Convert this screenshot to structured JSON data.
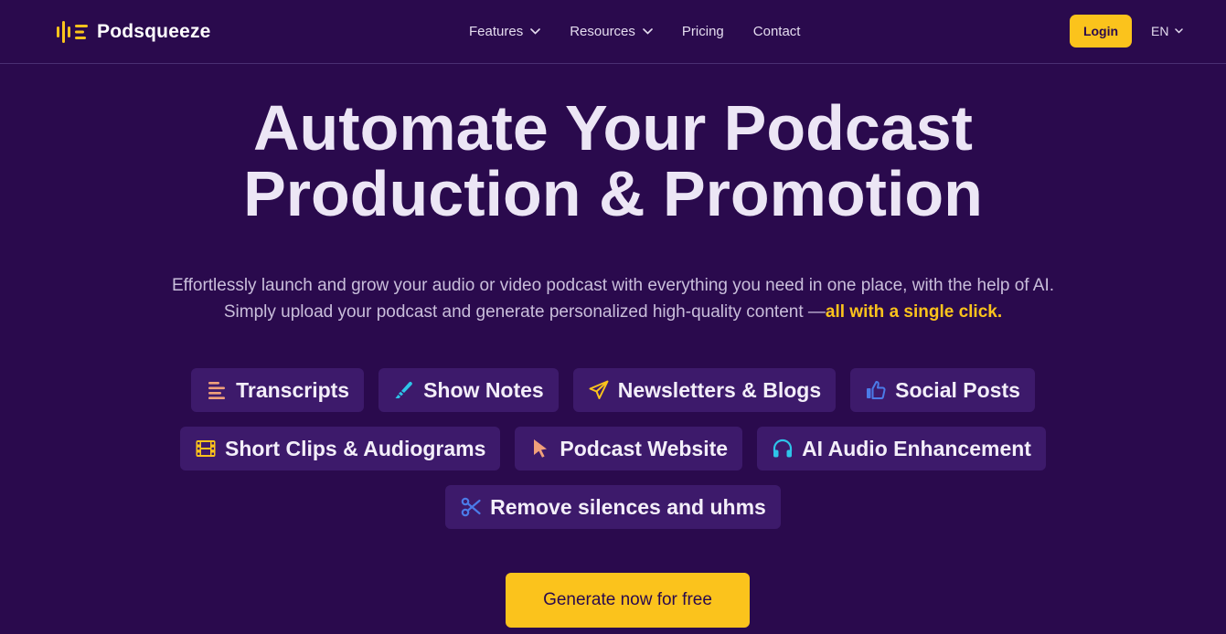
{
  "brand": {
    "name": "Podsqueeze",
    "accent": "#fbc31c",
    "background": "#2a0a4d"
  },
  "nav": {
    "items": [
      {
        "label": "Features",
        "dropdown": true
      },
      {
        "label": "Resources",
        "dropdown": true
      },
      {
        "label": "Pricing",
        "dropdown": false
      },
      {
        "label": "Contact",
        "dropdown": false
      }
    ],
    "login_label": "Login",
    "language": "EN"
  },
  "hero": {
    "title_line1": "Automate Your Podcast",
    "title_line2": "Production & Promotion",
    "subtitle_line1": "Effortlessly launch and grow your audio or video podcast with everything you need in one place, with the help of AI.",
    "subtitle_line2_prefix": "Simply upload your podcast and generate personalized high-quality content —",
    "subtitle_line2_highlight": "all with a single click."
  },
  "features": [
    {
      "label": "Transcripts",
      "icon": "lines-icon",
      "color": "#f0a07a"
    },
    {
      "label": "Show Notes",
      "icon": "highlighter-icon",
      "color": "#2ec4e8"
    },
    {
      "label": "Newsletters & Blogs",
      "icon": "paper-plane-icon",
      "color": "#fbc31c"
    },
    {
      "label": "Social Posts",
      "icon": "thumbs-up-icon",
      "color": "#4b7be8"
    },
    {
      "label": "Short Clips & Audiograms",
      "icon": "film-icon",
      "color": "#fbc31c"
    },
    {
      "label": "Podcast Website",
      "icon": "cursor-icon",
      "color": "#f0a07a"
    },
    {
      "label": "AI Audio Enhancement",
      "icon": "headphones-icon",
      "color": "#2ec4e8"
    },
    {
      "label": "Remove silences and uhms",
      "icon": "scissors-icon",
      "color": "#4b7be8"
    }
  ],
  "cta": {
    "label": "Generate now for free"
  }
}
